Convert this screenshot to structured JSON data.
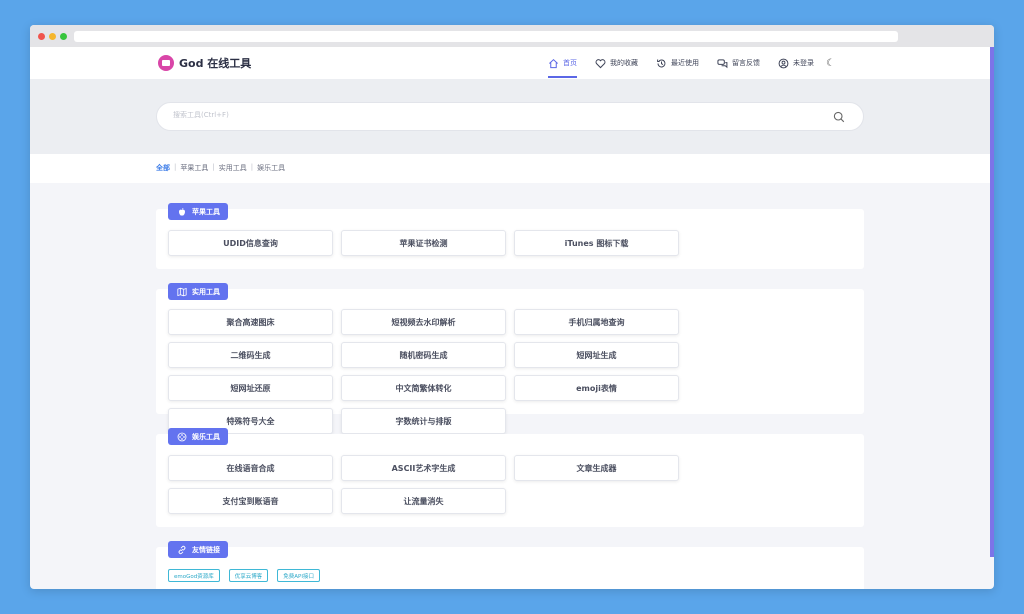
{
  "header": {
    "logo": "God 在线工具",
    "nav": [
      {
        "label": "首页",
        "icon": "home-icon",
        "active": true
      },
      {
        "label": "我的收藏",
        "icon": "heart-icon",
        "active": false
      },
      {
        "label": "最近使用",
        "icon": "history-icon",
        "active": false
      },
      {
        "label": "留言反馈",
        "icon": "chat-icon",
        "active": false
      },
      {
        "label": "未登录",
        "icon": "user-icon",
        "active": false
      }
    ],
    "theme_icon": "moon-icon"
  },
  "search": {
    "placeholder": "搜索工具(Ctrl+F)"
  },
  "categories": {
    "all": "全部",
    "items": [
      "苹果工具",
      "实用工具",
      "娱乐工具"
    ],
    "separator": "|"
  },
  "sections": [
    {
      "title": "苹果工具",
      "icon": "apple-icon",
      "tools": [
        "UDID信息查询",
        "苹果证书检测",
        "iTunes 图标下载"
      ]
    },
    {
      "title": "实用工具",
      "icon": "map-icon",
      "tools": [
        "聚合高速图床",
        "短视频去水印解析",
        "手机归属地查询",
        "二维码生成",
        "随机密码生成",
        "短网址生成",
        "短网址还原",
        "中文简繁体转化",
        "emoji表情",
        "特殊符号大全",
        "字数统计与排版"
      ]
    },
    {
      "title": "娱乐工具",
      "icon": "film-icon",
      "tools": [
        "在线语音合成",
        "ASCII艺术字生成",
        "文章生成器",
        "支付宝到账语音",
        "让流量消失"
      ]
    }
  ],
  "friends": {
    "title": "友情链接",
    "icon": "link-icon",
    "links": [
      "emoGod资源库",
      "优享云博客",
      "免费API接口"
    ]
  },
  "colors": {
    "accent": "#5b67e6",
    "badge": "#6373ef",
    "link": "#2aa8c8",
    "background": "#5aa5ea"
  }
}
